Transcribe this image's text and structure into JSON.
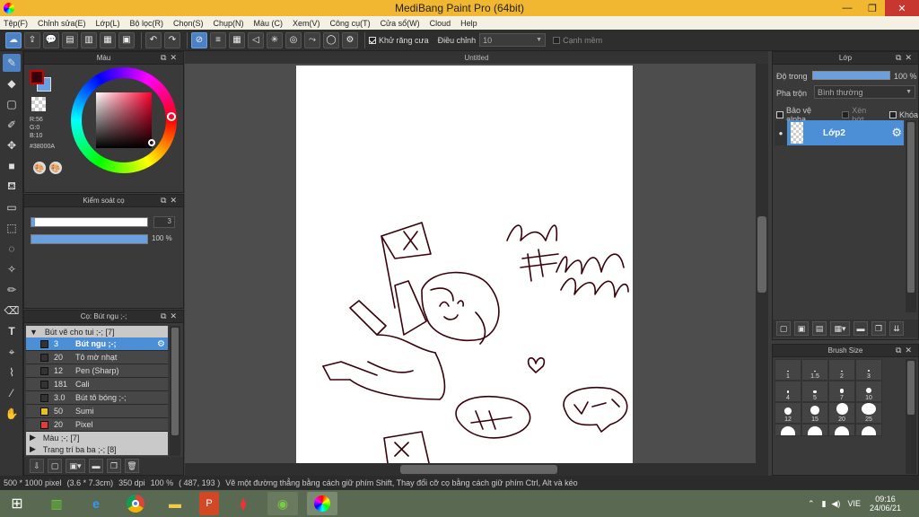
{
  "titlebar": {
    "title": "MediBang Paint Pro (64bit)"
  },
  "menu": [
    "Tệp(F)",
    "Chỉnh sửa(E)",
    "Lớp(L)",
    "Bộ lọc(R)",
    "Chọn(S)",
    "Chụp(N)",
    "Màu (C)",
    "Xem(V)",
    "Công cụ(T)",
    "Cửa sổ(W)",
    "Cloud",
    "Help"
  ],
  "toolbar": {
    "antialias_label": "Khử răng cưa",
    "adjust_label": "Điều chỉnh",
    "adjust_value": "10",
    "edge_label": "Cạnh mềm"
  },
  "color_panel": {
    "title": "Màu",
    "r": "R:56",
    "g": "G:0",
    "b": "B:10",
    "hex": "#38000A",
    "primary_color": "#38000A",
    "secondary_color": "#6aa0e0"
  },
  "brush_control": {
    "title": "Kiểm soát cọ",
    "size_value": "3",
    "size_fraction": 0.03,
    "opacity_value": "100 %",
    "opacity_fraction": 1.0
  },
  "brush_panel": {
    "title": "Cọ: Bút ngu ;-;",
    "groups": [
      {
        "name": "Bút vẽ cho tui ;-; [7]",
        "items": [
          {
            "size": "3",
            "name": "Bút ngu ;-;",
            "color": "#333333",
            "selected": true
          },
          {
            "size": "20",
            "name": "Tô mờ nhạt",
            "color": "#333333",
            "selected": false
          },
          {
            "size": "12",
            "name": "Pen (Sharp)",
            "color": "#333333",
            "selected": false
          },
          {
            "size": "181",
            "name": "Cali",
            "color": "#333333",
            "selected": false
          },
          {
            "size": "3.0",
            "name": "Bút tô bóng ;-;",
            "color": "#333333",
            "selected": false
          },
          {
            "size": "50",
            "name": "Sumi",
            "color": "#e8c21a",
            "selected": false
          },
          {
            "size": "20",
            "name": "Pixel",
            "color": "#e03a3a",
            "selected": false
          }
        ]
      },
      {
        "name": "Màu ;-; [7]"
      },
      {
        "name": "Trang trí ba ba ;-; [8]"
      }
    ]
  },
  "document": {
    "tab_title": "Untitled"
  },
  "layer_panel": {
    "title": "Lớp",
    "opacity_label": "Độ trong",
    "opacity_value": "100 %",
    "blend_label": "Pha trộn",
    "blend_value": "Bình thường",
    "protect_alpha": "Bảo vệ alpha",
    "clipping": "Xén bớt",
    "lock": "Khóa",
    "layer_name": "Lớp2"
  },
  "brush_size_panel": {
    "title": "Brush Size",
    "sizes": [
      "1",
      "1.5",
      "2",
      "3",
      "4",
      "5",
      "7",
      "10",
      "12",
      "15",
      "20",
      "25"
    ]
  },
  "status": {
    "size": "500 * 1000 pixel",
    "physical": "(3.6 * 7.3cm)",
    "dpi": "350 dpi",
    "zoom": "100 %",
    "coords": "( 487, 193 )",
    "hint": "Vẽ một đường thẳng bằng cách giữ phím Shift, Thay đổi cỡ cọ bằng cách giữ phím Ctrl, Alt và kéo"
  },
  "taskbar": {
    "lang": "VIE",
    "time": "09:16",
    "date": "24/06/21"
  }
}
